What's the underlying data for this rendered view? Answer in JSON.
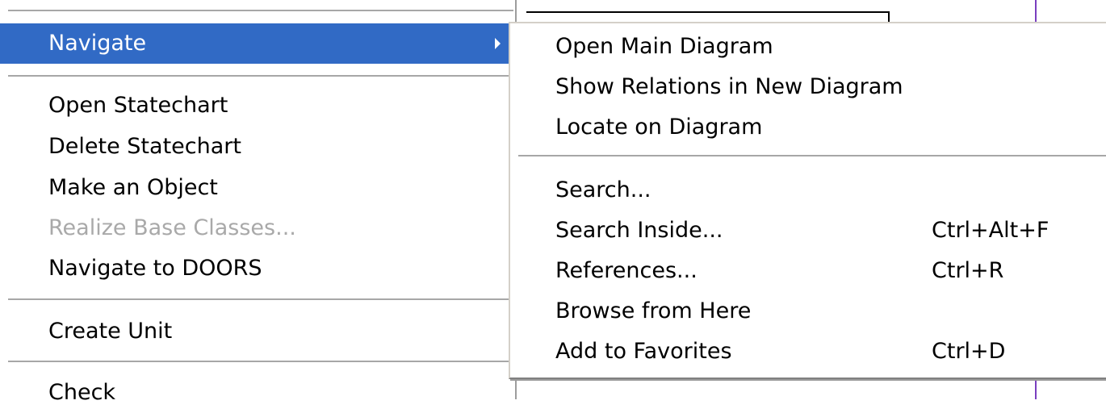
{
  "context_menu": {
    "items": [
      {
        "label": "Navigate",
        "highlighted": true,
        "has_submenu": true
      },
      {
        "label": "Open Statechart"
      },
      {
        "label": "Delete Statechart"
      },
      {
        "label": "Make an Object"
      },
      {
        "label": "Realize Base Classes...",
        "disabled": true
      },
      {
        "label": "Navigate to DOORS"
      },
      {
        "label": "Create Unit"
      },
      {
        "label": "Check"
      }
    ]
  },
  "submenu": {
    "items": [
      {
        "label": "Open Main Diagram"
      },
      {
        "label": "Show Relations in New Diagram"
      },
      {
        "label": "Locate on Diagram"
      },
      {
        "label": "Search..."
      },
      {
        "label": "Search Inside...",
        "shortcut": "Ctrl+Alt+F"
      },
      {
        "label": "References...",
        "shortcut": "Ctrl+R"
      },
      {
        "label": "Browse from Here"
      },
      {
        "label": "Add to Favorites",
        "shortcut": "Ctrl+D"
      }
    ]
  },
  "colors": {
    "highlight": "#316ac5",
    "disabled_text": "#a9a9a9",
    "separator": "#a7a7a7",
    "canvas_accent": "#7a3fbf"
  },
  "icons": {
    "submenu_arrow": "triangle-right-icon"
  }
}
